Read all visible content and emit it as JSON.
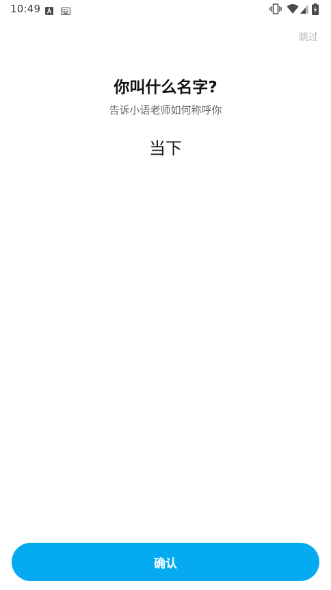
{
  "status_bar": {
    "time": "10:49",
    "icons": [
      "a-notification-icon",
      "keyboard-icon",
      "vibrate-icon",
      "wifi-icon",
      "signal-icon",
      "battery-charging-icon"
    ]
  },
  "header": {
    "skip_label": "跳过"
  },
  "main": {
    "title": "你叫什么名字?",
    "subtitle": "告诉小语老师如何称呼你",
    "name_value": "当下"
  },
  "footer": {
    "confirm_label": "确认"
  },
  "colors": {
    "accent": "#05aaf1",
    "skip_text": "#b3b3b3",
    "subtitle_text": "#666666"
  }
}
